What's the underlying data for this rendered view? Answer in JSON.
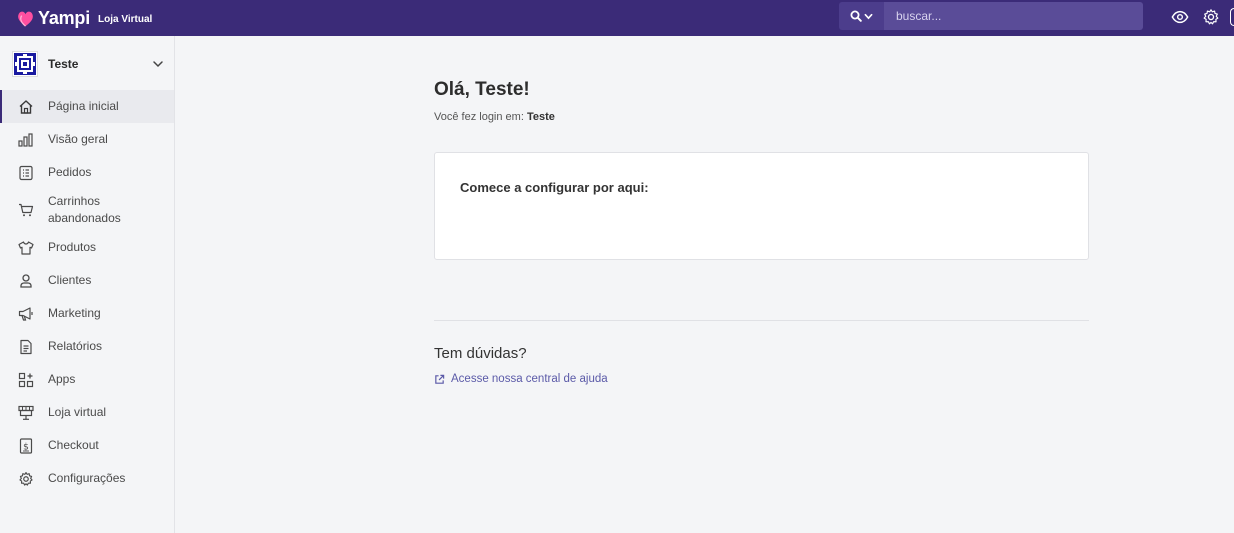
{
  "header": {
    "brand": "Yampi",
    "sub_brand": "Loja Virtual",
    "search_placeholder": "buscar...",
    "icons": [
      "search-icon",
      "chevron-down-icon",
      "eye-icon",
      "gear-icon"
    ],
    "bar_color": "#3b2b78"
  },
  "sidebar": {
    "store_name": "Teste",
    "items": [
      {
        "label": "Página inicial",
        "icon": "home-icon",
        "active": true
      },
      {
        "label": "Visão geral",
        "icon": "bar-chart-icon"
      },
      {
        "label": "Pedidos",
        "icon": "list-icon"
      },
      {
        "label": "Carrinhos abandonados",
        "icon": "cart-icon"
      },
      {
        "label": "Produtos",
        "icon": "shirt-icon"
      },
      {
        "label": "Clientes",
        "icon": "user-icon"
      },
      {
        "label": "Marketing",
        "icon": "megaphone-icon"
      },
      {
        "label": "Relatórios",
        "icon": "document-icon"
      },
      {
        "label": "Apps",
        "icon": "apps-icon"
      },
      {
        "label": "Loja virtual",
        "icon": "storefront-icon"
      },
      {
        "label": "Checkout",
        "icon": "checkout-icon"
      },
      {
        "label": "Configurações",
        "icon": "gear-icon"
      }
    ]
  },
  "main": {
    "greeting": "Olá, Teste!",
    "login_prefix": "Você fez login em:",
    "login_store": "Teste",
    "card_title": "Comece a configurar por aqui:",
    "help_title": "Tem dúvidas?",
    "help_link": "Acesse nossa central de ajuda",
    "link_color": "#5b5aa8"
  }
}
